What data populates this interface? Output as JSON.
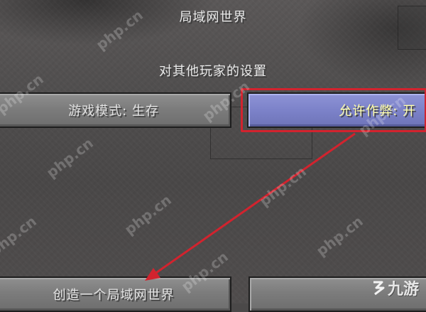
{
  "screen": {
    "title": "局域网世界",
    "subtitle": "对其他玩家的设置"
  },
  "buttons": {
    "game_mode": "游戏模式: 生存",
    "allow_cheats": "允许作弊: 开",
    "create_world": "创造一个局域网世界",
    "cancel": ""
  },
  "watermark": {
    "text": "php.cn"
  },
  "brand": {
    "logo_text": "九游"
  },
  "colors": {
    "button_default": "#7c7c7c",
    "button_hover": "#7c82c9",
    "highlight_red": "#d2232e",
    "annotation_arrow": "#d2232e"
  },
  "annotation": {
    "type": "arrow",
    "from": "allow-cheats-button",
    "to": "create-lan-world-button"
  }
}
